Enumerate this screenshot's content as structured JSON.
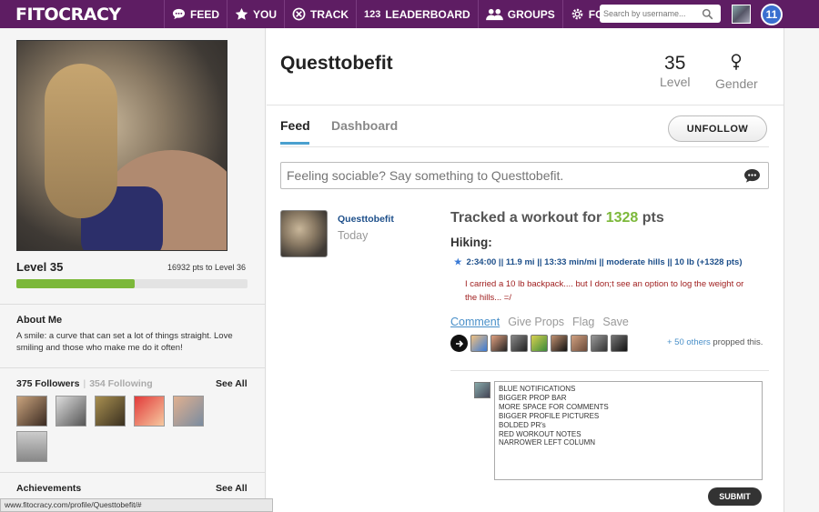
{
  "nav": {
    "logo": "FITOCRACY",
    "items": [
      {
        "label": "FEED",
        "icon": "speech-bubble-icon"
      },
      {
        "label": "YOU",
        "icon": "star-icon"
      },
      {
        "label": "TRACK",
        "icon": "track-icon"
      },
      {
        "label": "LEADERBOARD",
        "icon": "leaderboard-icon"
      },
      {
        "label": "GROUPS",
        "icon": "groups-icon"
      },
      {
        "label": "FORUM",
        "icon": "gear-icon"
      }
    ],
    "leaderboard_prefix": "123",
    "search_placeholder": "Search by username...",
    "notifications": "11"
  },
  "sidebar": {
    "level": "Level 35",
    "pts_to_next": "16932 pts to Level 36",
    "progress_fraction": 0.51,
    "about_title": "About Me",
    "about_text": "A smile: a curve that can set a lot of things straight. Love smiling and those who make me do it often!",
    "followers": "375 Followers",
    "following": "354 Following",
    "see_all": "See All",
    "achievements": "Achievements",
    "achievements_see_all": "See All",
    "status_url": "www.fitocracy.com/profile/Questtobefit/#"
  },
  "profile": {
    "username": "Questtobefit",
    "level_value": "35",
    "level_label": "Level",
    "gender_label": "Gender",
    "gender_icon": "female-symbol-icon"
  },
  "tabs": {
    "feed": "Feed",
    "dashboard": "Dashboard",
    "unfollow": "UNFOLLOW"
  },
  "post": {
    "placeholder": "Feeling sociable? Say something to Questtobefit."
  },
  "feed_item": {
    "user": "Questtobefit",
    "time": "Today",
    "title_prefix": "Tracked a workout for ",
    "points": "1328",
    "title_suffix": " pts",
    "exercise": "Hiking:",
    "set": "2:34:00 || 11.9 mi || 13:33 min/mi || moderate hills || 10 lb (+1328 pts)",
    "note": "I carried a 10 lb backpack.... but I don;t see an option to log the weight or the hills... =/",
    "actions": {
      "comment": "Comment",
      "give_props": "Give Props",
      "flag": "Flag",
      "save": "Save"
    },
    "props_others": "+ 50 others",
    "props_suffix": " propped this.",
    "comment_text": "BLUE NOTIFICATIONS\nBIGGER PROP BAR\nMORE SPACE FOR COMMENTS\nBIGGER PROFILE PICTURES\nBOLDED PR's\nRED WORKOUT NOTES\nNARROWER LEFT COLUMN",
    "submit": "SUBMIT"
  },
  "colors": {
    "nav_bg": "#5e1d63",
    "progress_green": "#7cb83a",
    "link_blue": "#1d4f8a",
    "note_red": "#a02020"
  }
}
